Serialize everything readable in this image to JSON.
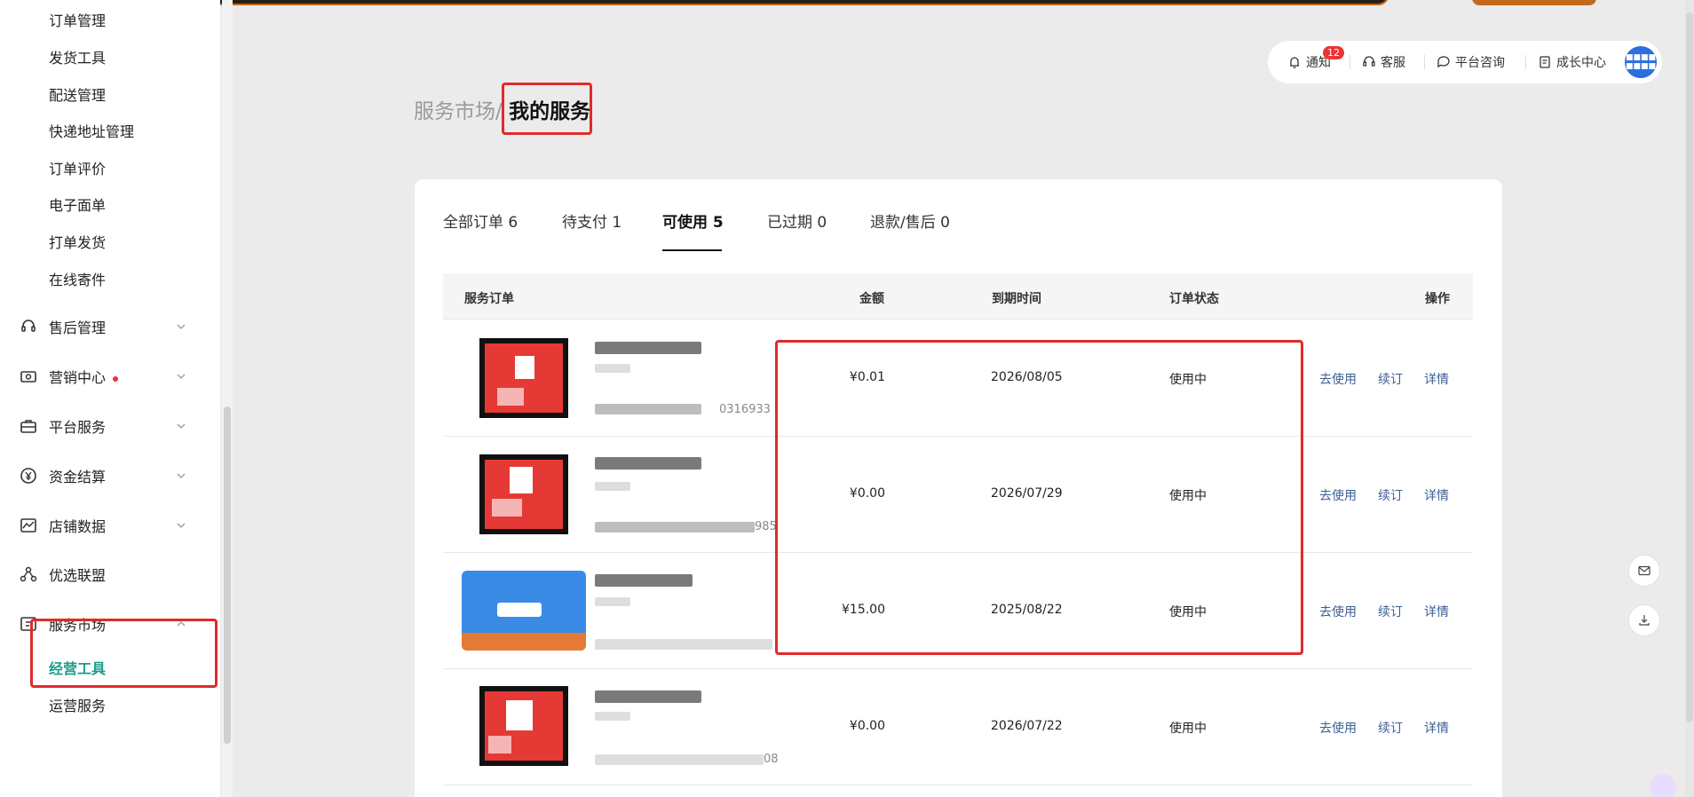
{
  "sidebar": {
    "sub_items_top": [
      "订单管理",
      "发货工具",
      "配送管理",
      "快递地址管理",
      "订单评价",
      "电子面单",
      "打单发货",
      "在线寄件"
    ],
    "menu": [
      {
        "label": "售后管理",
        "icon": "headset-icon"
      },
      {
        "label": "营销中心",
        "icon": "coupon-icon",
        "dot": true
      },
      {
        "label": "平台服务",
        "icon": "briefcase-icon"
      },
      {
        "label": "资金结算",
        "icon": "yen-icon"
      },
      {
        "label": "店铺数据",
        "icon": "chart-icon"
      },
      {
        "label": "优选联盟",
        "icon": "network-icon"
      },
      {
        "label": "服务市场",
        "icon": "market-icon"
      }
    ],
    "market_sub": [
      "经营工具",
      "运营服务"
    ]
  },
  "toolbar": {
    "notify": "通知",
    "notify_badge": "12",
    "service": "客服",
    "consult": "平台咨询",
    "growth": "成长中心",
    "avatar_text": "■■■■ ■■■■"
  },
  "breadcrumb": {
    "parent": "服务市场",
    "sep": "/",
    "current": "我的服务"
  },
  "tabs": [
    {
      "label": "全部订单 6"
    },
    {
      "label": "待支付 1"
    },
    {
      "label": "可使用 5"
    },
    {
      "label": "已过期 0"
    },
    {
      "label": "退款/售后 0"
    }
  ],
  "table": {
    "headers": {
      "order": "服务订单",
      "amount": "金额",
      "expire": "到期时间",
      "status": "订单状态",
      "ops": "操作"
    },
    "rows": [
      {
        "tail": "0316933",
        "amount": "¥0.01",
        "expire": "2026/08/05",
        "status": "使用中"
      },
      {
        "tail": "985",
        "amount": "¥0.00",
        "expire": "2026/07/29",
        "status": "使用中"
      },
      {
        "tail": "",
        "amount": "¥15.00",
        "expire": "2025/08/22",
        "status": "使用中"
      },
      {
        "tail": "08",
        "amount": "¥0.00",
        "expire": "2026/07/22",
        "status": "使用中"
      }
    ],
    "actions": {
      "use": "去使用",
      "renew": "续订",
      "detail": "详情"
    }
  },
  "colors": {
    "accent_green": "#1a9c8a",
    "highlight_red": "#e02a2a",
    "link_blue": "#3b5e95"
  }
}
